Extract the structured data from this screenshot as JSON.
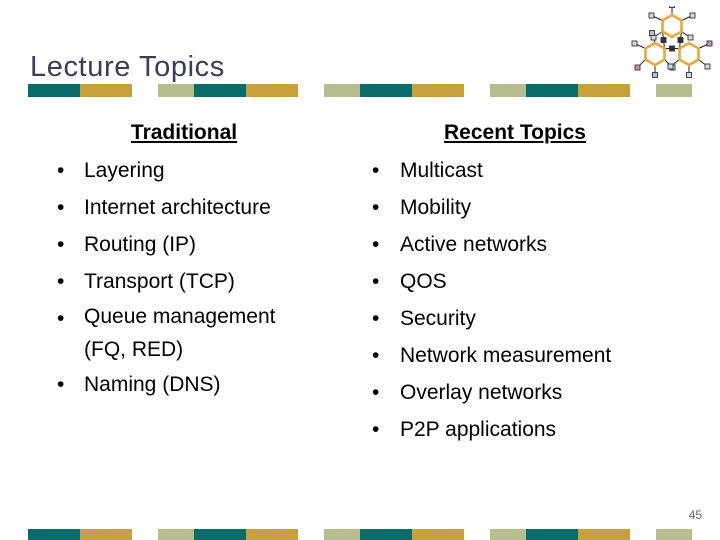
{
  "slide": {
    "title": "Lecture Topics",
    "page_number": "45",
    "title_color": "#3b3b5c",
    "background_color": "#ffffff",
    "text_color": "#000000"
  },
  "decor": {
    "bar_colors": {
      "teal": "#0a6b6b",
      "gold": "#c9a13a",
      "sage": "#b6bd8e",
      "slate": "#6b6b9e"
    },
    "header_bar_name": "header-decorative-bar",
    "footer_bar_name": "footer-decorative-bar"
  },
  "logo": {
    "name": "molecule-logo",
    "ring_color": "#e8a83a",
    "node_fill": "#d8d8e4",
    "node_stroke": "#333333",
    "bond_color": "#222222",
    "accent_pink": "#d48fb5",
    "accent_lilac": "#b9b9dd"
  },
  "columns": [
    {
      "id": "traditional",
      "heading": "Traditional",
      "items": [
        {
          "text": "Layering",
          "bullet": "•"
        },
        {
          "text": "Internet architecture",
          "bullet": "•"
        },
        {
          "text": "Routing (IP)",
          "bullet": "•"
        },
        {
          "text": "Transport (TCP)",
          "bullet": "•"
        },
        {
          "text": "Queue management\n(FQ, RED)",
          "bullet": "•"
        },
        {
          "text": "Naming (DNS)",
          "bullet": "•"
        }
      ]
    },
    {
      "id": "recent",
      "heading": "Recent Topics",
      "items": [
        {
          "text": "Multicast",
          "bullet": "•"
        },
        {
          "text": "Mobility",
          "bullet": "•"
        },
        {
          "text": "Active networks",
          "bullet": "•"
        },
        {
          "text": "QOS",
          "bullet": "•"
        },
        {
          "text": "Security",
          "bullet": "•"
        },
        {
          "text": "Network measurement",
          "bullet": "•"
        },
        {
          "text": "Overlay networks",
          "bullet": "•"
        },
        {
          "text": "P2P applications",
          "bullet": "•"
        }
      ]
    }
  ]
}
